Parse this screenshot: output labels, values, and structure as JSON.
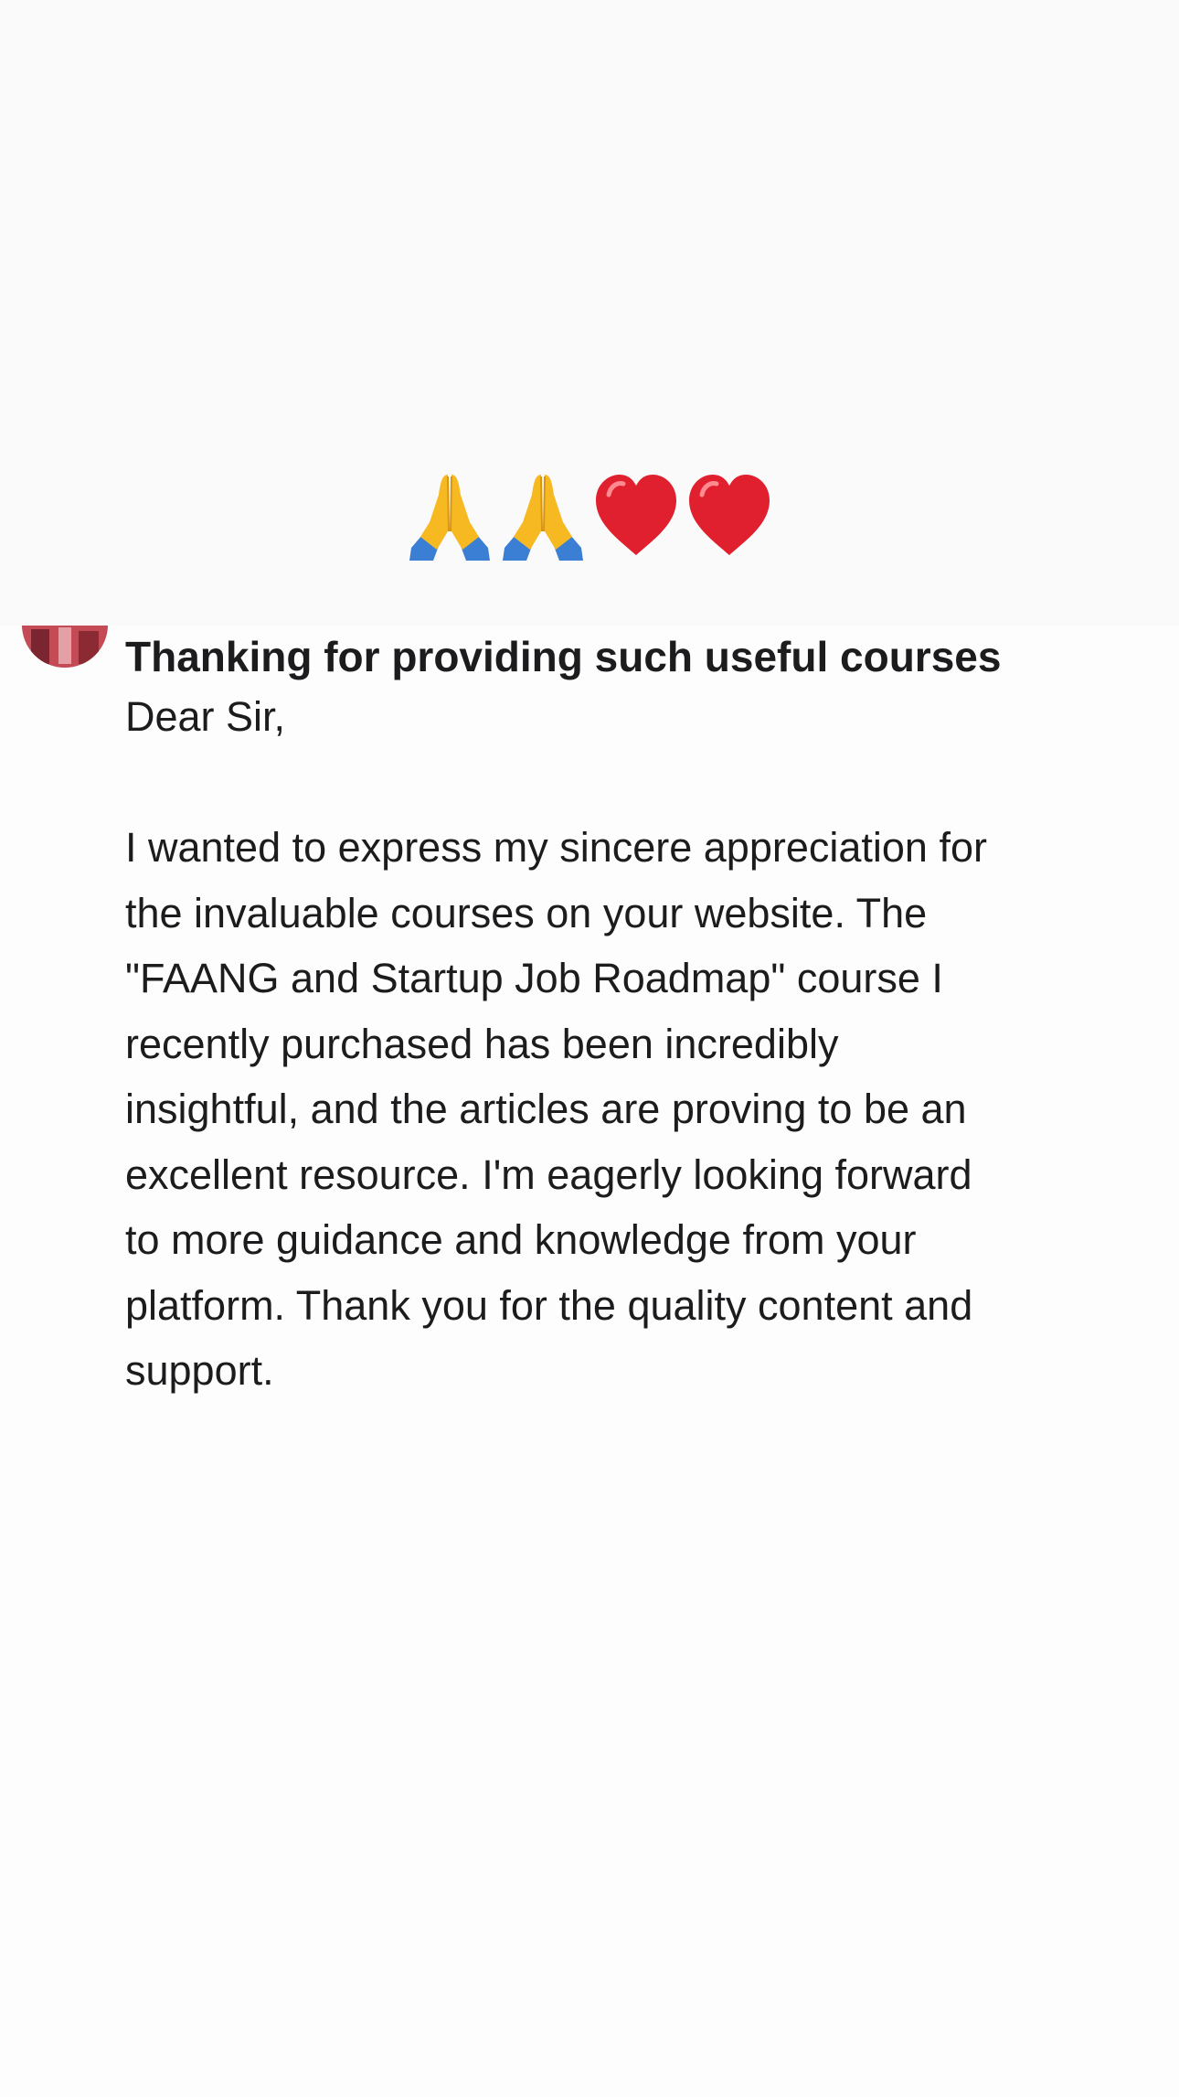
{
  "banner": {
    "emojis": [
      {
        "icon": "folded-hands-icon",
        "char": "🙏"
      },
      {
        "icon": "folded-hands-icon",
        "char": "🙏"
      },
      {
        "icon": "red-heart-icon",
        "char": "❤️"
      },
      {
        "icon": "red-heart-icon",
        "char": "❤️"
      }
    ]
  },
  "message": {
    "subject": "Thanking for providing such useful courses",
    "greeting": "Dear Sir,",
    "body_lines": [
      "I wanted to express my sincere appreciation for",
      "the invaluable courses on your website. The",
      "\"FAANG and Startup Job Roadmap\" course I",
      "recently purchased has been incredibly",
      "insightful, and the articles are proving to be an",
      "excellent resource. I'm eagerly looking forward",
      "to more guidance and knowledge from your",
      "platform. Thank you for the quality content and",
      "support."
    ]
  },
  "colors": {
    "text": "#1c1c1e",
    "background": "#fdfdfd",
    "heart": "#e0202e",
    "hands": "#f6b922",
    "sleeve": "#3b7fd4"
  }
}
